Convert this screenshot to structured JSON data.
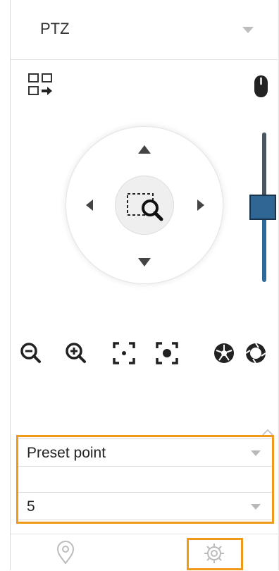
{
  "panel": {
    "title": "PTZ"
  },
  "icons": {
    "layout_switch": "layout-switch-icon",
    "mouse": "mouse-icon",
    "dpad_center": "area-zoom-icon",
    "zoom_out": "zoom-out-icon",
    "zoom_in": "zoom-in-icon",
    "focus_near": "focus-near-icon",
    "focus_far": "focus-far-icon",
    "iris_close": "iris-close-icon",
    "iris_open": "iris-open-icon",
    "location": "location-pin-icon",
    "settings": "gear-icon"
  },
  "speed_slider": {
    "level_fraction": 0.5
  },
  "function_select": {
    "value": "Preset point"
  },
  "number_select": {
    "value": "5"
  },
  "colors": {
    "highlight": "#f09a1b",
    "slider_fill": "#2e6a98",
    "slider_thumb": "#2f6694"
  }
}
